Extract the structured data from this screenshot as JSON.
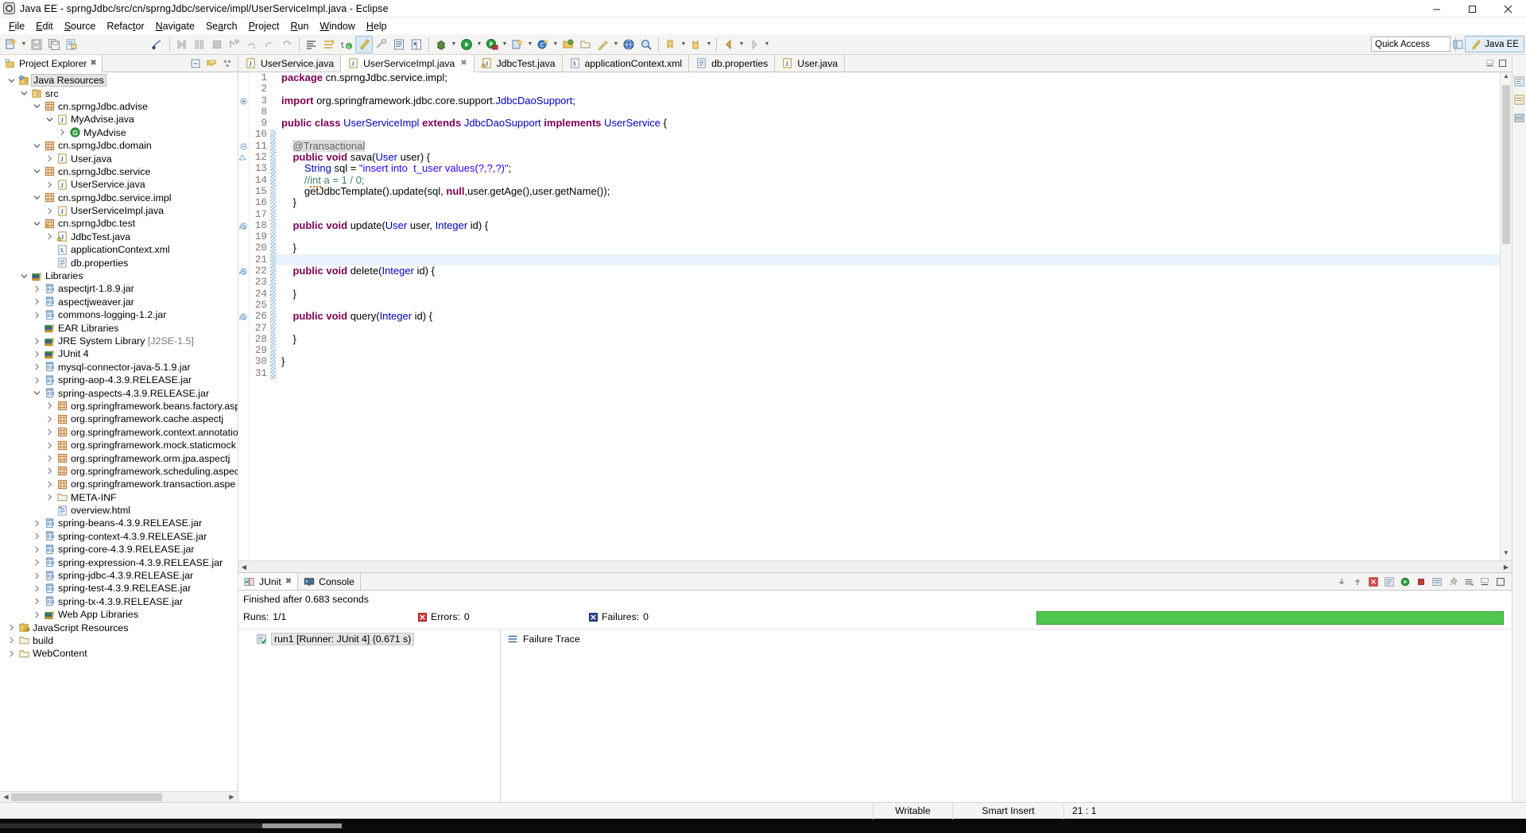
{
  "window": {
    "title": "Java EE - sprngJdbc/src/cn/sprngJdbc/service/impl/UserServiceImpl.java - Eclipse",
    "app_icon": "eclipse-icon",
    "minimize": "minimize-button",
    "maximize": "maximize-button",
    "close": "close-button"
  },
  "menubar": {
    "items": [
      {
        "label": "File",
        "mnemonic": "F"
      },
      {
        "label": "Edit",
        "mnemonic": "E"
      },
      {
        "label": "Source",
        "mnemonic": "S"
      },
      {
        "label": "Refactor",
        "mnemonic": "t"
      },
      {
        "label": "Navigate",
        "mnemonic": "N"
      },
      {
        "label": "Search",
        "mnemonic": "a"
      },
      {
        "label": "Project",
        "mnemonic": "P"
      },
      {
        "label": "Run",
        "mnemonic": "R"
      },
      {
        "label": "Window",
        "mnemonic": "W"
      },
      {
        "label": "Help",
        "mnemonic": "H"
      }
    ]
  },
  "toolbar": {
    "quick_access_placeholder": "Quick Access",
    "perspective_label": "Java EE",
    "buttons": [
      "new-wizard-icon",
      "save-icon",
      "save-all-icon",
      "print-icon",
      "no-link-icon",
      "step-over-icon",
      "step-into-icon",
      "terminate-icon",
      "debug-step-icon",
      "step-return-icon",
      "resume-icon",
      "restart-icon",
      "toggle-breakpoint-icon",
      "skip-breakpoints-icon",
      "open-type-icon",
      "java-perspective-icon",
      "external-tools-icon",
      "open-task-icon",
      "pilcrow-icon",
      "debug-icon",
      "run-icon",
      "run-server-icon",
      "new-project-icon",
      "new-class-icon",
      "open-resource-icon",
      "search-icon",
      "next-annotation-icon",
      "previous-annotation-icon",
      "back-icon",
      "forward-icon"
    ]
  },
  "explorer": {
    "tab_label": "Project Explorer",
    "tab_icon": "project-explorer-icon",
    "tools": [
      "collapse-all-icon",
      "link-with-editor-icon",
      "view-menu-icon"
    ],
    "tree": [
      {
        "indent": 1,
        "arrow": "down",
        "icon": "java-resources-icon",
        "label": "Java Resources",
        "selected": true
      },
      {
        "indent": 2,
        "arrow": "down",
        "icon": "source-folder-icon",
        "label": "src"
      },
      {
        "indent": 3,
        "arrow": "down",
        "icon": "package-icon",
        "label": "cn.sprngJdbc.advise"
      },
      {
        "indent": 4,
        "arrow": "down",
        "icon": "java-file-icon",
        "label": "MyAdvise.java"
      },
      {
        "indent": 5,
        "arrow": "right",
        "icon": "class-icon",
        "label": "MyAdvise"
      },
      {
        "indent": 3,
        "arrow": "down",
        "icon": "package-icon",
        "label": "cn.sprngJdbc.domain"
      },
      {
        "indent": 4,
        "arrow": "right",
        "icon": "java-file-icon",
        "label": "User.java"
      },
      {
        "indent": 3,
        "arrow": "down",
        "icon": "package-icon",
        "label": "cn.sprngJdbc.service"
      },
      {
        "indent": 4,
        "arrow": "right",
        "icon": "java-file-icon",
        "label": "UserService.java"
      },
      {
        "indent": 3,
        "arrow": "down",
        "icon": "package-icon",
        "label": "cn.sprngJdbc.service.impl"
      },
      {
        "indent": 4,
        "arrow": "right",
        "icon": "java-file-icon",
        "label": "UserServiceImpl.java"
      },
      {
        "indent": 3,
        "arrow": "down",
        "icon": "package-warning-icon",
        "label": "cn.sprngJdbc.test"
      },
      {
        "indent": 4,
        "arrow": "right",
        "icon": "java-file-warning-icon",
        "label": "JdbcTest.java"
      },
      {
        "indent": 4,
        "arrow": "none",
        "icon": "xml-file-icon",
        "label": "applicationContext.xml"
      },
      {
        "indent": 4,
        "arrow": "none",
        "icon": "properties-file-icon",
        "label": "db.properties"
      },
      {
        "indent": 2,
        "arrow": "down",
        "icon": "libraries-icon",
        "label": "Libraries"
      },
      {
        "indent": 3,
        "arrow": "right",
        "icon": "jar-icon",
        "label": "aspectjrt-1.8.9.jar"
      },
      {
        "indent": 3,
        "arrow": "right",
        "icon": "jar-icon",
        "label": "aspectjweaver.jar"
      },
      {
        "indent": 3,
        "arrow": "right",
        "icon": "jar-icon",
        "label": "commons-logging-1.2.jar"
      },
      {
        "indent": 3,
        "arrow": "none",
        "icon": "libraries-icon",
        "label": "EAR Libraries"
      },
      {
        "indent": 3,
        "arrow": "right",
        "icon": "libraries-icon",
        "label": "JRE System Library",
        "suffix": "[J2SE-1.5]"
      },
      {
        "indent": 3,
        "arrow": "right",
        "icon": "libraries-icon",
        "label": "JUnit 4"
      },
      {
        "indent": 3,
        "arrow": "right",
        "icon": "jar-icon",
        "label": "mysql-connector-java-5.1.9.jar"
      },
      {
        "indent": 3,
        "arrow": "right",
        "icon": "jar-icon",
        "label": "spring-aop-4.3.9.RELEASE.jar"
      },
      {
        "indent": 3,
        "arrow": "down",
        "icon": "jar-icon",
        "label": "spring-aspects-4.3.9.RELEASE.jar"
      },
      {
        "indent": 4,
        "arrow": "right",
        "icon": "package-icon",
        "label": "org.springframework.beans.factory.asp"
      },
      {
        "indent": 4,
        "arrow": "right",
        "icon": "package-icon",
        "label": "org.springframework.cache.aspectj"
      },
      {
        "indent": 4,
        "arrow": "right",
        "icon": "package-icon",
        "label": "org.springframework.context.annotatio"
      },
      {
        "indent": 4,
        "arrow": "right",
        "icon": "package-icon",
        "label": "org.springframework.mock.staticmock"
      },
      {
        "indent": 4,
        "arrow": "right",
        "icon": "package-icon",
        "label": "org.springframework.orm.jpa.aspectj"
      },
      {
        "indent": 4,
        "arrow": "right",
        "icon": "package-icon",
        "label": "org.springframework.scheduling.aspec"
      },
      {
        "indent": 4,
        "arrow": "right",
        "icon": "package-icon",
        "label": "org.springframework.transaction.aspe"
      },
      {
        "indent": 4,
        "arrow": "right",
        "icon": "folder-icon",
        "label": "META-INF"
      },
      {
        "indent": 4,
        "arrow": "none",
        "icon": "html-file-icon",
        "label": "overview.html"
      },
      {
        "indent": 3,
        "arrow": "right",
        "icon": "jar-icon",
        "label": "spring-beans-4.3.9.RELEASE.jar"
      },
      {
        "indent": 3,
        "arrow": "right",
        "icon": "jar-icon",
        "label": "spring-context-4.3.9.RELEASE.jar"
      },
      {
        "indent": 3,
        "arrow": "right",
        "icon": "jar-icon",
        "label": "spring-core-4.3.9.RELEASE.jar"
      },
      {
        "indent": 3,
        "arrow": "right",
        "icon": "jar-icon",
        "label": "spring-expression-4.3.9.RELEASE.jar"
      },
      {
        "indent": 3,
        "arrow": "right",
        "icon": "jar-icon",
        "label": "spring-jdbc-4.3.9.RELEASE.jar"
      },
      {
        "indent": 3,
        "arrow": "right",
        "icon": "jar-icon",
        "label": "spring-test-4.3.9.RELEASE.jar"
      },
      {
        "indent": 3,
        "arrow": "right",
        "icon": "jar-icon",
        "label": "spring-tx-4.3.9.RELEASE.jar"
      },
      {
        "indent": 3,
        "arrow": "right",
        "icon": "libraries-icon",
        "label": "Web App Libraries"
      },
      {
        "indent": 1,
        "arrow": "right",
        "icon": "js-resources-icon",
        "label": "JavaScript Resources"
      },
      {
        "indent": 1,
        "arrow": "right",
        "icon": "folder-icon",
        "label": "build"
      },
      {
        "indent": 1,
        "arrow": "right",
        "icon": "folder-icon",
        "label": "WebContent"
      }
    ]
  },
  "editor": {
    "tabs": [
      {
        "label": "UserService.java",
        "icon": "java-file-icon",
        "active": false,
        "closable": false
      },
      {
        "label": "UserServiceImpl.java",
        "icon": "java-file-icon",
        "active": true,
        "closable": true
      },
      {
        "label": "JdbcTest.java",
        "icon": "java-file-warning-icon",
        "active": false,
        "closable": false
      },
      {
        "label": "applicationContext.xml",
        "icon": "xml-file-icon",
        "active": false,
        "closable": false
      },
      {
        "label": "db.properties",
        "icon": "properties-file-icon",
        "active": false,
        "closable": false
      },
      {
        "label": "User.java",
        "icon": "java-file-icon",
        "active": false,
        "closable": false
      }
    ],
    "highlighted_line": 21,
    "lines": [
      {
        "n": 1,
        "fold": "none",
        "text": "package cn.sprngJdbc.service.impl;"
      },
      {
        "n": 2,
        "fold": "none",
        "text": ""
      },
      {
        "n": 3,
        "fold": "plus",
        "text": "import org.springframework.jdbc.core.support.JdbcDaoSupport;"
      },
      {
        "n": 8,
        "fold": "none",
        "text": ""
      },
      {
        "n": 9,
        "fold": "none",
        "text": "public class UserServiceImpl extends JdbcDaoSupport implements UserService {"
      },
      {
        "n": 10,
        "fold": "none",
        "text": ""
      },
      {
        "n": 11,
        "fold": "minus",
        "text": "    @Transactional"
      },
      {
        "n": 12,
        "fold": "none",
        "text": "    public void sava(User user) {"
      },
      {
        "n": 13,
        "fold": "none",
        "text": "        String sql = \"insert into  t_user values(?,?,?)\";"
      },
      {
        "n": 14,
        "fold": "none",
        "text": "        //int a = 1 / 0;"
      },
      {
        "n": 15,
        "fold": "none",
        "text": "        getJdbcTemplate().update(sql, null,user.getAge(),user.getName());"
      },
      {
        "n": 16,
        "fold": "none",
        "text": "    }"
      },
      {
        "n": 17,
        "fold": "none",
        "text": ""
      },
      {
        "n": 18,
        "fold": "minus",
        "text": "    public void update(User user, Integer id) {"
      },
      {
        "n": 19,
        "fold": "none",
        "text": ""
      },
      {
        "n": 20,
        "fold": "none",
        "text": "    }"
      },
      {
        "n": 21,
        "fold": "none",
        "text": ""
      },
      {
        "n": 22,
        "fold": "minus",
        "text": "    public void delete(Integer id) {"
      },
      {
        "n": 23,
        "fold": "none",
        "text": ""
      },
      {
        "n": 24,
        "fold": "none",
        "text": "    }"
      },
      {
        "n": 25,
        "fold": "none",
        "text": ""
      },
      {
        "n": 26,
        "fold": "minus",
        "text": "    public void query(Integer id) {"
      },
      {
        "n": 27,
        "fold": "none",
        "text": ""
      },
      {
        "n": 28,
        "fold": "none",
        "text": "    }"
      },
      {
        "n": 29,
        "fold": "none",
        "text": ""
      },
      {
        "n": 30,
        "fold": "none",
        "text": "}"
      },
      {
        "n": 31,
        "fold": "none",
        "text": ""
      }
    ]
  },
  "bottom_panel": {
    "tabs": [
      {
        "label": "JUnit",
        "icon": "junit-icon",
        "active": true,
        "closable": true
      },
      {
        "label": "Console",
        "icon": "console-icon",
        "active": false,
        "closable": false
      }
    ],
    "tools": [
      "next-failure-icon",
      "previous-failure-icon",
      "show-failures-only-icon",
      "rerun-test-icon",
      "rerun-failed-icon",
      "stop-icon",
      "history-icon",
      "pin-icon",
      "view-menu-icon",
      "minimize-icon",
      "maximize-icon"
    ],
    "junit": {
      "status": "Finished after 0.683 seconds",
      "runs_label": "Runs:",
      "runs_value": "1/1",
      "errors_label": "Errors:",
      "errors_value": "0",
      "failures_label": "Failures:",
      "failures_value": "0",
      "progress_color": "#4ec94e",
      "tree_items": [
        {
          "label": "run1 [Runner: JUnit 4] (0.671 s)",
          "icon": "test-pass-icon",
          "selected": true
        }
      ],
      "failure_trace_label": "Failure Trace",
      "failure_trace_icon": "failure-trace-icon"
    }
  },
  "statusbar": {
    "writable": "Writable",
    "insert_mode": "Smart Insert",
    "cursor_position": "21 : 1"
  },
  "colors": {
    "keyword": "#7f0055",
    "string": "#2a00ff",
    "comment": "#3f7f5f",
    "annotation": "#646464",
    "field": "#0000c0",
    "accent": "#4ec94e",
    "selection": "#e8f2fc",
    "chrome": "#f4f4f2"
  }
}
